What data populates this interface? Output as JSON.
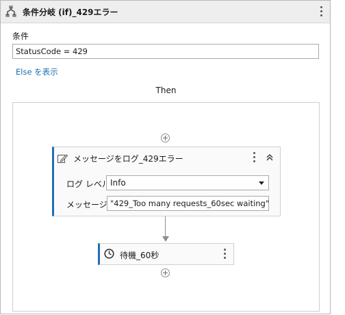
{
  "header": {
    "title": "条件分岐 (if)_429エラー",
    "icon": "if-branch-icon"
  },
  "condition": {
    "label": "条件",
    "value": "StatusCode = 429"
  },
  "else_link": "Else を表示",
  "then_label": "Then",
  "log_activity": {
    "title": "メッセージをログ_429エラー",
    "icon": "log-message-icon",
    "level_label": "ログ レベル",
    "level_value": "Info",
    "message_label": "メッセージ",
    "message_value": "\"429_Too many requests_60sec waiting\""
  },
  "delay_activity": {
    "title": "待機_60秒",
    "icon": "clock-icon"
  },
  "colors": {
    "accent": "#1e6fb5",
    "link": "#1a6fb4",
    "header_bg": "#eeeeee"
  }
}
